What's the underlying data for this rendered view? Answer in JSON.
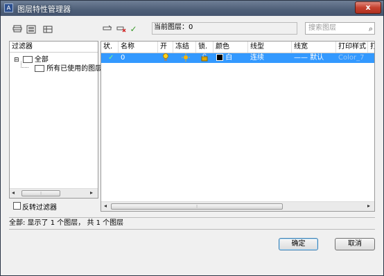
{
  "window": {
    "title": "图层特性管理器",
    "close_symbol": "x"
  },
  "toolbar": {
    "current_layer_label": "当前图层：",
    "current_layer_value": "0",
    "search_placeholder": "搜索图层"
  },
  "filter_panel": {
    "header": "过滤器",
    "tree": [
      {
        "label": "全部",
        "expander": "⊟"
      },
      {
        "label": "所有已使用的图层"
      }
    ],
    "invert_label": "反转过滤器"
  },
  "layers_table": {
    "columns": [
      "状.",
      "名称",
      "开",
      "冻结",
      "锁.",
      "颜色",
      "线型",
      "线宽",
      "打印样式",
      "打"
    ],
    "rows": [
      {
        "status": "✓",
        "name": "0",
        "color_name": "白",
        "linetype": "连续",
        "lineweight": "—— 默认",
        "plot_style": "Color_7"
      }
    ]
  },
  "status_bar": {
    "text": "全部:   显示了 1 个图层，  共 1 个图层"
  },
  "buttons": {
    "ok": "确定",
    "cancel": "取消"
  },
  "colors": {
    "selection": "#3399ff",
    "title_bar": "#5a6b84",
    "layer_color": "#000000"
  }
}
